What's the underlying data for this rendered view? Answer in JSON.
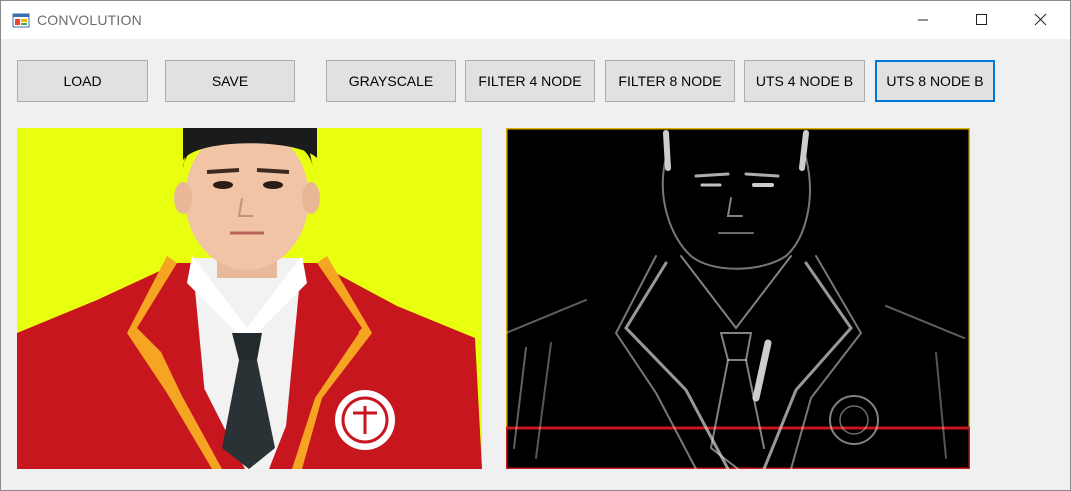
{
  "window": {
    "title": "CONVOLUTION",
    "icon": "winforms-app-icon",
    "controls": [
      "minimize-icon",
      "maximize-icon",
      "close-icon"
    ]
  },
  "toolbar": {
    "load_label": "LOAD",
    "save_label": "SAVE",
    "grayscale_label": "GRAYSCALE",
    "filter4_label": "FILTER 4 NODE",
    "filter8_label": "FILTER 8 NODE",
    "uts4_label": "UTS 4 NODE B",
    "uts8_label": "UTS 8 NODE B"
  },
  "images": {
    "original": "color portrait photo: person in red blazer with yellow trim, white shirt, dark tie, school badge, yellow background",
    "result": "edge-detection output of the same portrait: white outlines on black background"
  },
  "colors": {
    "focus_border": "#0078d7",
    "button_bg": "#e1e1e1",
    "photo_background": "#e9ff10",
    "blazer_red": "#c8161f"
  }
}
